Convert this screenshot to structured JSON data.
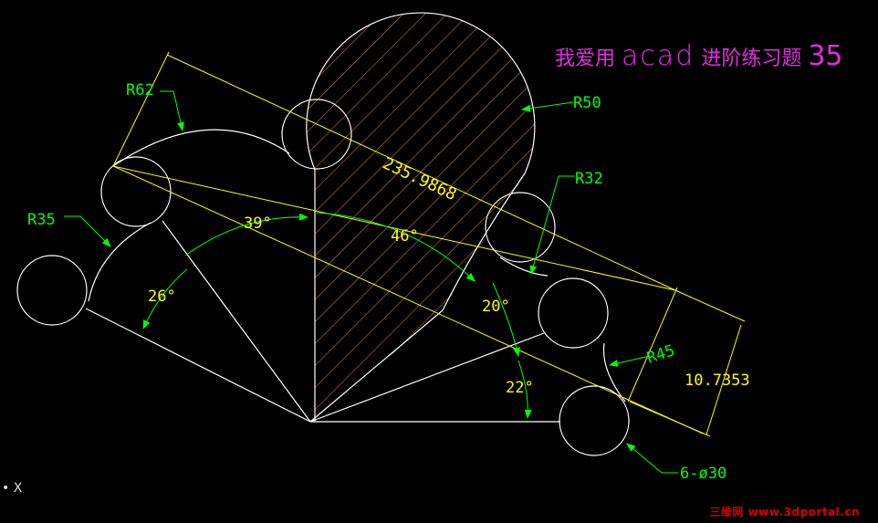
{
  "title": {
    "prefix": "我爱用",
    "latin": "acad",
    "suffix": "进阶练习题",
    "number": "35"
  },
  "labels": {
    "r62": "R62",
    "r50": "R50",
    "r32": "R32",
    "r35": "R35",
    "r45": "R45",
    "dim_long": "235.9868",
    "dim_short": "10.7353",
    "ang39": "39°",
    "ang46": "46°",
    "ang26": "26°",
    "ang20": "20°",
    "ang22": "22°",
    "holes": "6-ø30"
  },
  "ucs": "• X",
  "watermark": "三维网 www.3dportal.cn",
  "colors": {
    "background": "#000000",
    "geometry": "#ffffff",
    "dimension": "#ffff00",
    "leader": "#00ff00",
    "hatch": "#e09050",
    "title": "#e22ce0"
  }
}
